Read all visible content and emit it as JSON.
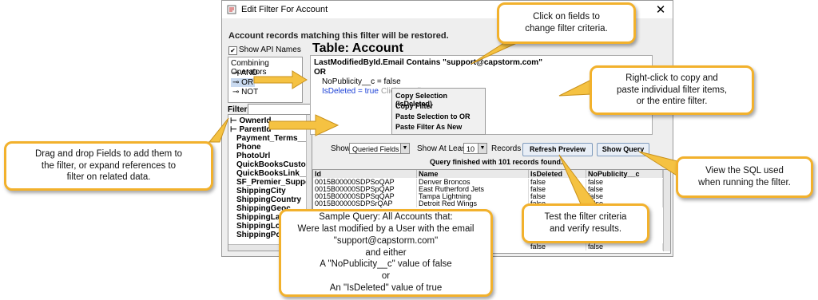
{
  "window": {
    "title": "Edit Filter For Account",
    "close_glyph": "✕"
  },
  "heading": "Account records matching this filter will be restored.",
  "show_api_names": {
    "label": "Show API Names",
    "checked": true
  },
  "operators": {
    "title": "Combining Operators",
    "items": [
      "AND",
      "OR",
      "NOT"
    ],
    "selected": "OR"
  },
  "filter": {
    "label": "Filter:",
    "value": ""
  },
  "fields": [
    "OwnerId",
    "ParentId",
    "Payment_Terms__c",
    "Phone",
    "PhotoUrl",
    "QuickBooksCustomer_",
    "QuickBooksLink__c",
    "SF_Premier_Support_",
    "ShippingCity",
    "ShippingCountry",
    "ShippingGeoc",
    "ShippingLatit",
    "ShippingLong",
    "ShippingPost"
  ],
  "table_title": "Table: Account",
  "expression": {
    "line1": "LastModifiedById.Email Contains \"support@capstorm.com\"",
    "line2": "OR",
    "line3": "NoPublicity__c = false",
    "line4": "IsDeleted = true",
    "line4_hint": "Click to Edit"
  },
  "context_menu": [
    "Copy Selection (IsDeleted)",
    "Copy Filter",
    "Paste Selection to OR",
    "Paste Filter As New"
  ],
  "controls": {
    "show_label": "Show:",
    "show_value": "Queried Fields",
    "at_least_label": "Show At Least",
    "at_least_value": "10",
    "records_label": "Records",
    "refresh_button": "Refresh Preview",
    "show_query_button": "Show Query"
  },
  "status": "Query finished with 101 records found.",
  "grid": {
    "headers": [
      "Id",
      "Name",
      "IsDeleted",
      "NoPublicity__c"
    ],
    "rows": [
      [
        "0015B00000SDPSoQAP",
        "Denver Broncos",
        "false",
        "false"
      ],
      [
        "0015B00000SDPSpQAP",
        "East Rutherford Jets",
        "false",
        "false"
      ],
      [
        "0015B00000SDPSqQAP",
        "Tampa Lightning",
        "false",
        "false"
      ],
      [
        "0015B00000SDPSrQAP",
        "Detroit Red Wings",
        "false",
        "false"
      ]
    ],
    "last_row": [
      "",
      "",
      "false",
      "false"
    ]
  },
  "callouts": {
    "click_fields": "Click on fields to\nchange filter criteria.",
    "right_click": "Right-click to copy and\npaste individual filter items,\nor the entire filter.",
    "drag_drop": "Drag and drop Fields to add them to\nthe filter, or expand references to\nfilter on related data.",
    "view_sql": "View the SQL used\nwhen running the filter.",
    "test_filter": "Test the filter criteria\nand verify results.",
    "sample_query": "Sample Query: All Accounts that:\nWere last modified by a User with the email\n\"support@capstorm.com\"\nand either\nA \"NoPublicity__c\" value of false\nor\nAn \"IsDeleted\" value of true"
  },
  "colors": {
    "callout_border": "#f2b12c",
    "arrow_fill": "#f5c242",
    "expr_blue": "#1a3fd6"
  }
}
